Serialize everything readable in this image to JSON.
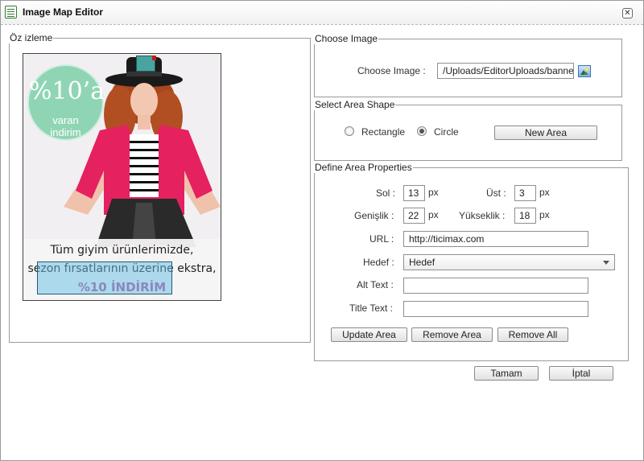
{
  "window": {
    "title": "Image Map Editor",
    "icon": "editor-window-icon",
    "close_icon": "close-icon"
  },
  "preview": {
    "legend": "Öz izleme",
    "badge": {
      "percent": "%10’a",
      "line1": "varan",
      "line2": "indirim"
    },
    "caption_line1": "Tüm giyim ürünlerimizde,",
    "caption_line2": "sezon fırsatlarının üzerine ekstra,",
    "caption_line3": "%10 İNDİRİM"
  },
  "choose_image": {
    "legend": "Choose Image",
    "label": "Choose Image :",
    "value": "/Uploads/EditorUploads/banner",
    "browse_icon": "image-browse-icon"
  },
  "area_shape": {
    "legend": "Select Area Shape",
    "options": [
      {
        "label": "Rectangle",
        "checked": false
      },
      {
        "label": "Circle",
        "checked": true
      }
    ],
    "new_area_label": "New Area"
  },
  "area_properties": {
    "legend": "Define Area Properties",
    "sol_label": "Sol :",
    "sol_value": "13",
    "sol_unit": "px",
    "ust_label": "Üst :",
    "ust_value": "3",
    "ust_unit": "px",
    "genislik_label": "Genişlik :",
    "genislik_value": "22",
    "genislik_unit": "px",
    "yukseklik_label": "Yükseklik :",
    "yukseklik_value": "18",
    "yukseklik_unit": "px",
    "url_label": "URL :",
    "url_value": "http://ticimax.com",
    "hedef_label": "Hedef :",
    "hedef_value": "Hedef",
    "alt_label": "Alt Text :",
    "alt_value": "",
    "title_label": "Title Text :",
    "title_value": "",
    "update_label": "Update Area",
    "remove_label": "Remove Area",
    "remove_all_label": "Remove All"
  },
  "footer": {
    "ok_label": "Tamam",
    "cancel_label": "İptal"
  }
}
